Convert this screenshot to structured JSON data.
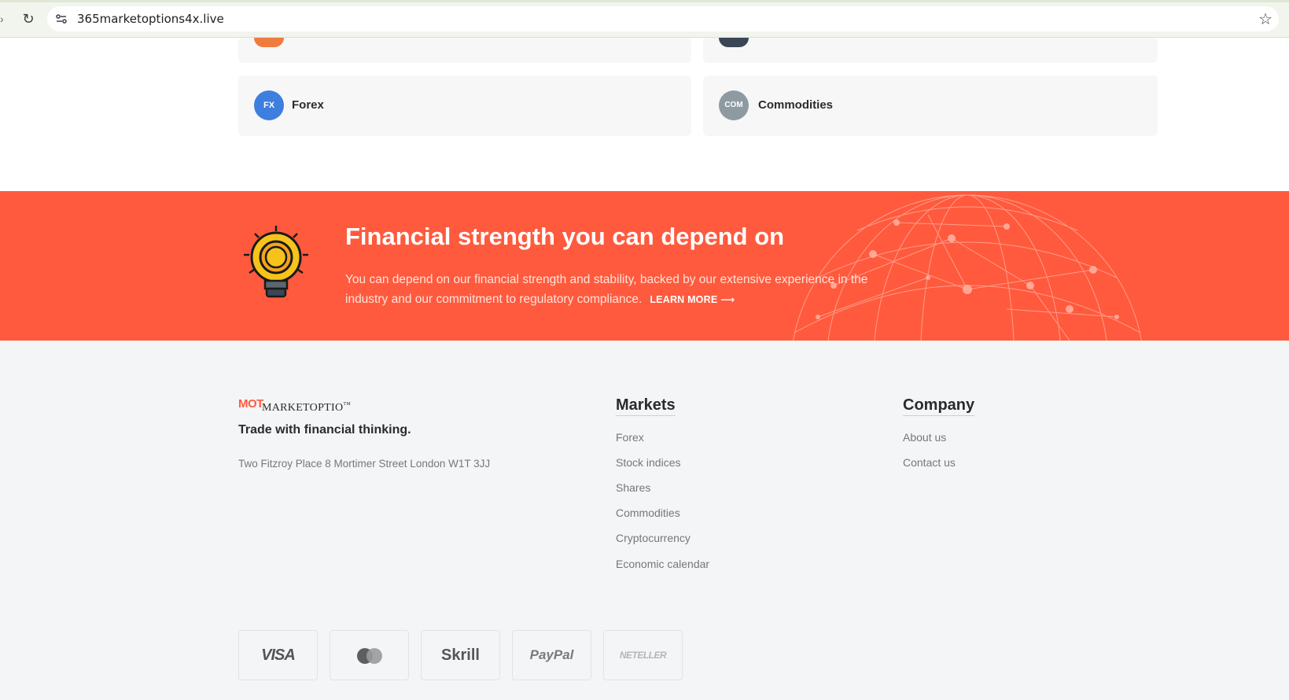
{
  "browser": {
    "url": "365marketoptions4x.live",
    "icons": [
      "forward-icon",
      "reload-icon",
      "site-settings-icon",
      "bookmark-star-icon"
    ]
  },
  "markets": {
    "cards": [
      {
        "badge": "FX",
        "label": "Forex",
        "color": "#3d7ede"
      },
      {
        "badge": "COM",
        "label": "Commodities",
        "color": "#8e9aa1"
      }
    ],
    "partial_colors": [
      "#f07b3f",
      "#3a4654"
    ]
  },
  "banner": {
    "title": "Financial strength you can depend on",
    "body": "You can depend on our financial strength and stability, backed by our extensive experience in the industry and our commitment to regulatory compliance.",
    "learn_more": "LEARN MORE",
    "arrow": "⟶",
    "background": "#ff5a3d"
  },
  "footer": {
    "logo_mark": "MOT",
    "logo_word": "MARKETOPTIO",
    "logo_sup": "TM",
    "tagline": "Trade with financial thinking.",
    "address": "Two Fitzroy Place 8 Mortimer Street London W1T 3JJ",
    "markets_title": "Markets",
    "markets_links": [
      "Forex",
      "Stock indices",
      "Shares",
      "Commodities",
      "Cryptocurrency",
      "Economic calendar"
    ],
    "company_title": "Company",
    "company_links": [
      "About us",
      "Contact us"
    ],
    "payments": [
      "VISA",
      "",
      "Skrill",
      "PayPal",
      "NETELLER"
    ]
  }
}
